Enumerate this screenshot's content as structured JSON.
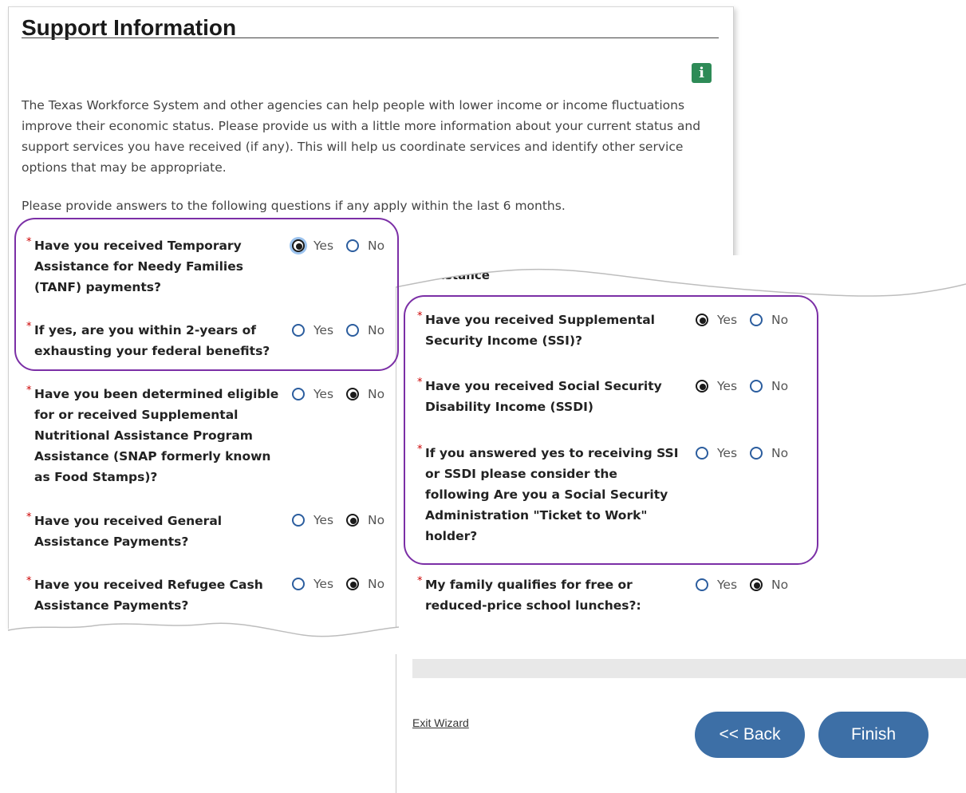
{
  "title": "Support Information",
  "info_icon": "i",
  "intro": "The Texas Workforce System and other agencies can help people with lower income or income fluctuations improve their economic status. Please provide us with a little more information about your current status and support services you have received (if any). This will help us coordinate services and identify other service options that may be appropriate.",
  "hint": "Please provide answers to the following questions if any apply within the last 6 months.",
  "required_mark": "*",
  "yes_label": "Yes",
  "no_label": "No",
  "left_questions": [
    {
      "text": "Have you received Temporary Assistance for Needy Families (TANF) payments?",
      "selected": "yes"
    },
    {
      "text": "If yes, are you within 2-years of exhausting your federal benefits?",
      "selected": "none"
    },
    {
      "text": "Have you been determined eligible for or received Supplemental Nutritional Assistance Program Assistance (SNAP formerly known as Food Stamps)?",
      "selected": "no"
    },
    {
      "text": "Have you received General Assistance Payments?",
      "selected": "no"
    },
    {
      "text": "Have you received Refugee Cash Assistance Payments?",
      "selected": "no"
    }
  ],
  "right_peek_text": "ssistance",
  "right_questions": [
    {
      "text": "Have you received Supplemental Security Income (SSI)?",
      "selected": "yes"
    },
    {
      "text": "Have you received Social Security Disability Income (SSDI)",
      "selected": "yes"
    },
    {
      "text": "If you answered yes to receiving SSI or SSDI please consider the following Are you a Social Security Administration \"Ticket to Work\" holder?",
      "selected": "none"
    },
    {
      "text": "My family qualifies for free or reduced-price school lunches?:",
      "selected": "no"
    }
  ],
  "exit_wizard": "Exit Wizard",
  "back_button": "<< Back",
  "finish_button": "Finish",
  "colors": {
    "highlight_circle": "#7b2fa6",
    "button": "#3d6fa6",
    "info_icon": "#2e8b57"
  }
}
